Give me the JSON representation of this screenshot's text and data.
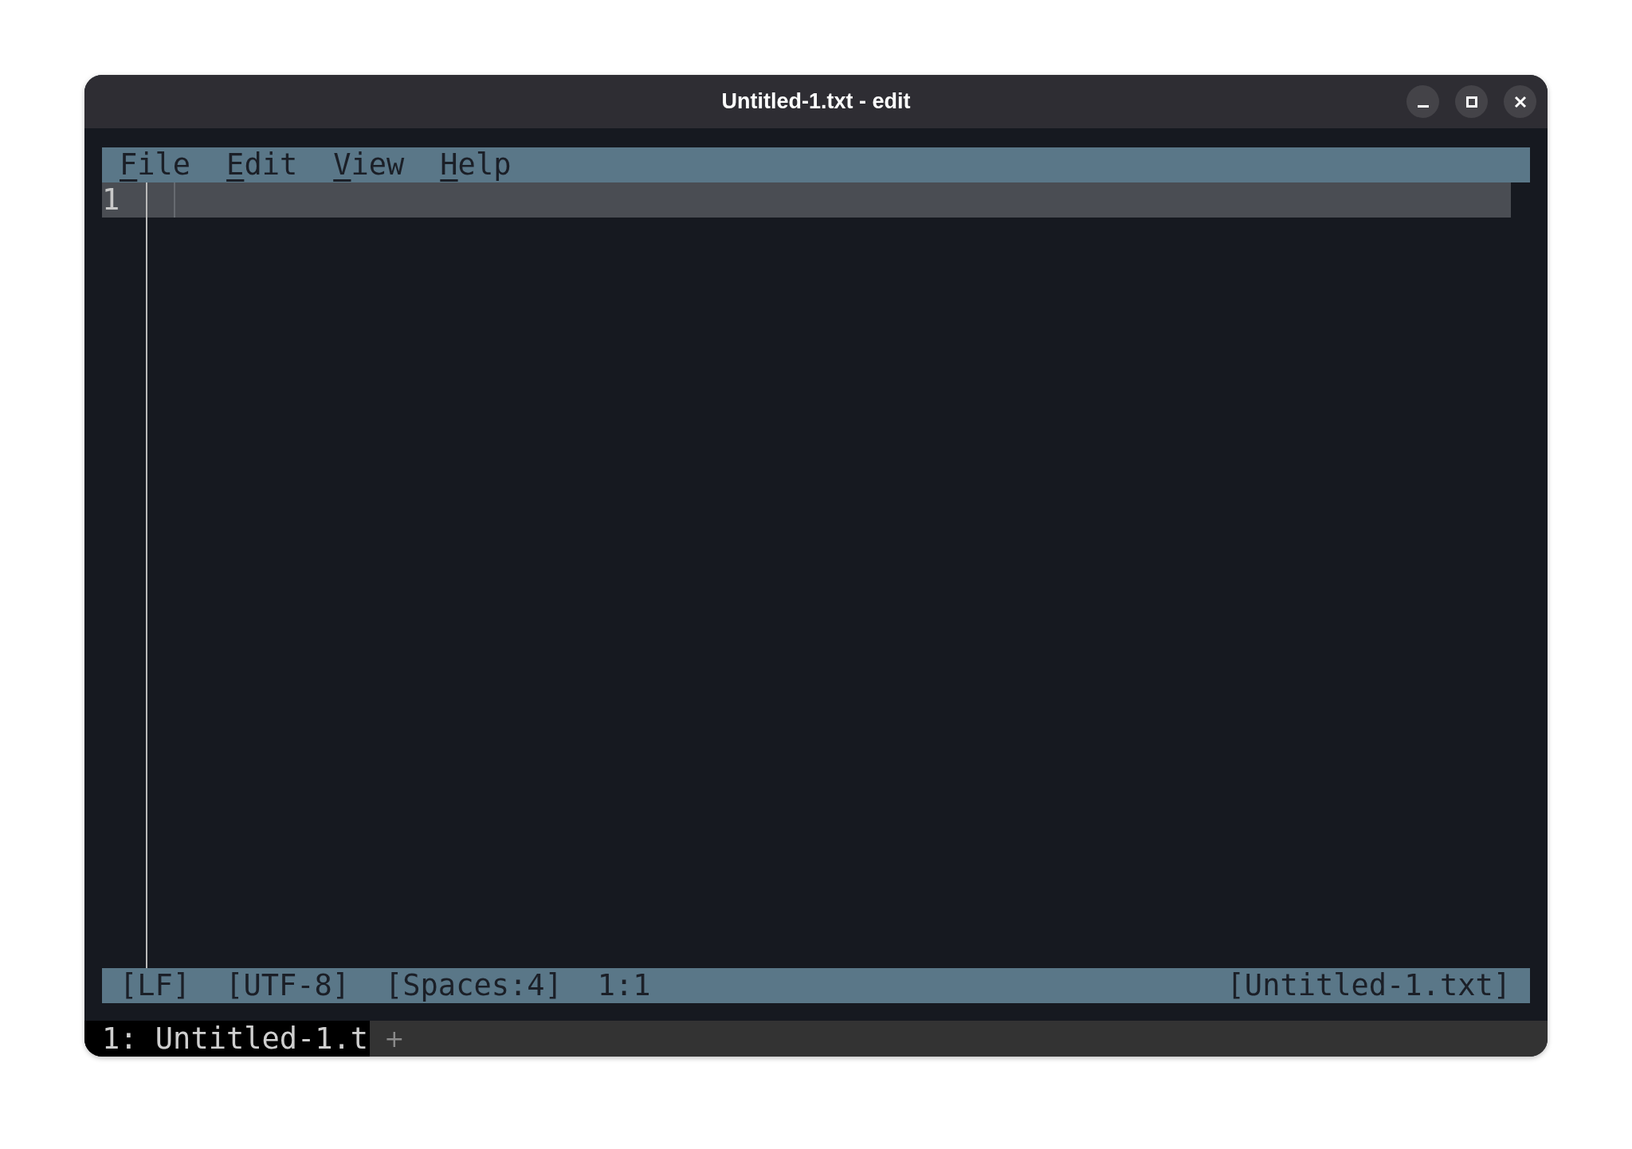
{
  "window": {
    "title": "Untitled-1.txt - edit"
  },
  "menu": [
    {
      "label": "File"
    },
    {
      "label": "Edit"
    },
    {
      "label": "View"
    },
    {
      "label": "Help"
    }
  ],
  "editor": {
    "line_numbers": [
      "1"
    ]
  },
  "status_bar": {
    "left": [
      "[LF]",
      "[UTF-8]",
      "[Spaces:4]",
      "1:1"
    ],
    "right": "[Untitled-1.txt]"
  },
  "tabs": [
    {
      "label": "1: Untitled-1.t",
      "selected": true
    }
  ],
  "new_tab": "+"
}
